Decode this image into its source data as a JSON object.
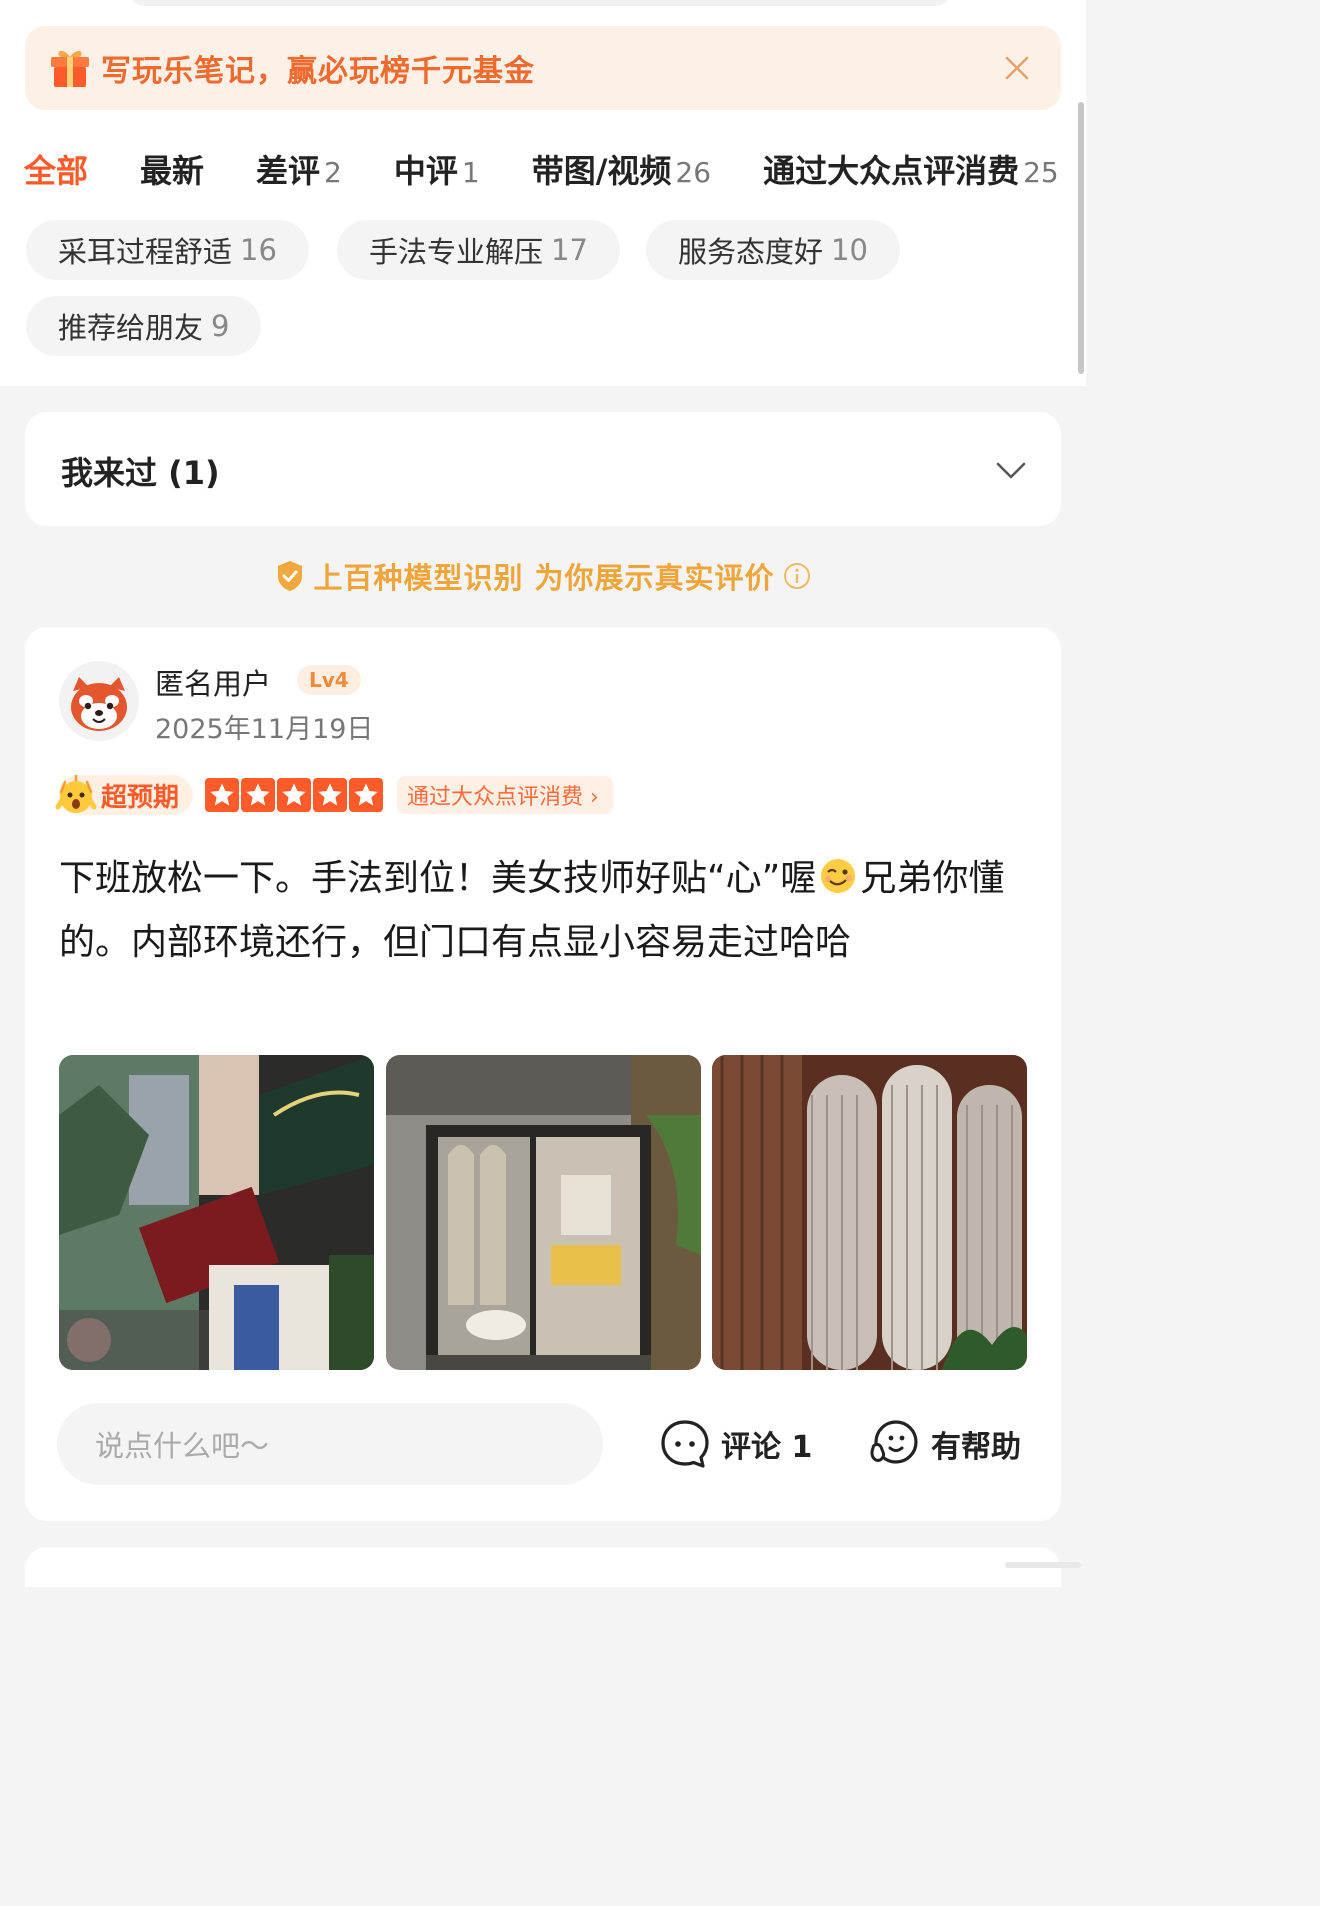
{
  "banner": {
    "text": "写玩乐笔记，赢必玩榜千元基金",
    "icon": "gift-icon",
    "close_icon": "close-icon"
  },
  "tabs": [
    {
      "label": "全部",
      "count": ""
    },
    {
      "label": "最新",
      "count": ""
    },
    {
      "label": "差评",
      "count": "2"
    },
    {
      "label": "中评",
      "count": "1"
    },
    {
      "label": "带图/视频",
      "count": "26"
    },
    {
      "label": "通过大众点评消费",
      "count": "25"
    }
  ],
  "tags": [
    {
      "label": "采耳过程舒适",
      "count": "16"
    },
    {
      "label": "手法专业解压",
      "count": "17"
    },
    {
      "label": "服务态度好",
      "count": "10"
    },
    {
      "label": "推荐给朋友",
      "count": "9"
    }
  ],
  "visited": {
    "title": "我来过 (1)",
    "icon": "chevron-down-icon"
  },
  "notice": {
    "text": "上百种模型识别 为你展示真实评价",
    "icon": "shield-check-icon",
    "info_icon": "info-icon"
  },
  "review": {
    "user": "匿名用户",
    "level": "Lv4",
    "date": "2025年11月19日",
    "badge": "超预期",
    "stars": 5,
    "consume_link": "通过大众点评消费 ›",
    "text_part1": "下班放松一下。手法到位！美女技师好贴“心”喔",
    "text_part2": "兄弟你懂的。内部环境还行，但门口有点显小容易走过哈哈",
    "photos": [
      "storefront-photo",
      "entrance-photo",
      "interior-glass-photo"
    ],
    "comment_placeholder": "说点什么吧～",
    "comment_label": "评论 1",
    "helpful_label": "有帮助"
  },
  "colors": {
    "accent": "#ff5a2a",
    "banner_bg": "#fdf0e6",
    "notice": "#f0a53a"
  }
}
